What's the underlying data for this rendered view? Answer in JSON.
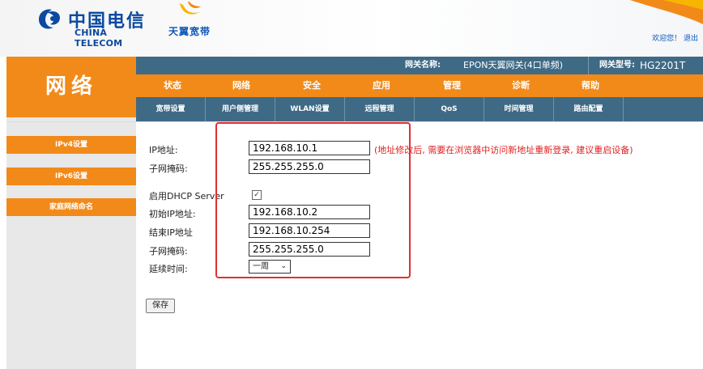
{
  "brand": {
    "logo_cn": "中国电信",
    "logo_en": "CHINA TELECOM",
    "tianyi": "天翼宽带",
    "welcome": "欢迎您！ 退出"
  },
  "left_title": "网络",
  "sidebar": {
    "items": [
      {
        "label": "IPv4设置"
      },
      {
        "label": "IPv6设置"
      },
      {
        "label": "家庭网络命名"
      }
    ]
  },
  "gateway": {
    "name_label": "网关名称:",
    "name_value": "EPON天翼网关(4口单频)",
    "model_label": "网关型号:",
    "model_value": "HG2201T"
  },
  "main_nav": [
    "状态",
    "网络",
    "安全",
    "应用",
    "管理",
    "诊断",
    "帮助"
  ],
  "sub_nav": [
    "宽带设置",
    "用户侧管理",
    "WLAN设置",
    "远程管理",
    "QoS",
    "时间管理",
    "路由配置"
  ],
  "form": {
    "ip_label": "IP地址:",
    "ip_value": "192.168.10.1",
    "mask_label": "子网掩码:",
    "mask_value": "255.255.255.0",
    "hint": "(地址修改后, 需要在浏览器中访问新地址重新登录, 建议重启设备)",
    "dhcp_label": "启用DHCP Server",
    "dhcp_checked": "✓",
    "start_label": "初始IP地址:",
    "start_value": "192.168.10.2",
    "end_label": "结束IP地址",
    "end_value": "192.168.10.254",
    "dhcp_mask_label": "子网掩码:",
    "dhcp_mask_value": "255.255.255.0",
    "lease_label": "延续时间:",
    "lease_value": "一周",
    "save_label": "保存"
  },
  "colors": {
    "accent_orange": "#f28a1a",
    "nav_blue": "#3f6a86",
    "brand_blue": "#0a4aa0",
    "highlight_red": "#e03030"
  }
}
